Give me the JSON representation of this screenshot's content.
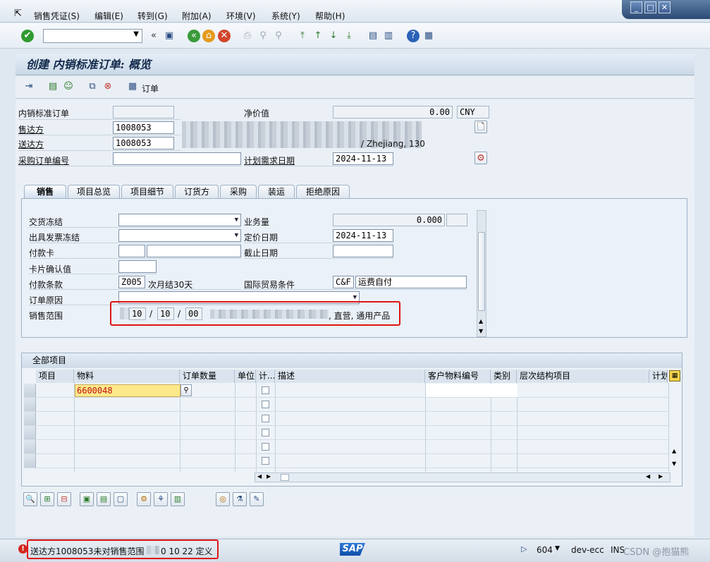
{
  "menu": [
    "销售凭证(S)",
    "编辑(E)",
    "转到(G)",
    "附加(A)",
    "环境(V)",
    "系统(Y)",
    "帮助(H)"
  ],
  "icons": {
    "menu_exit": "exit-icon",
    "enter": "check-icon",
    "save": "save-icon",
    "back": "back-icon",
    "exit": "exit-icon",
    "cancel": "cancel-icon",
    "help": "help-icon"
  },
  "title": "创建 内销标准订单: 概览",
  "apptoolbar": {
    "orders_label": "订单"
  },
  "header": {
    "order_label": "内销标准订单",
    "sold_to_label": "售达方",
    "sold_to_value": "1008053",
    "ship_to_label": "送达方",
    "ship_to_value": "1008053",
    "ship_to_address_tail": "/ Zhejiang, 130",
    "po_label": "采购订单编号",
    "net_value_label": "净价值",
    "net_value": "0.00",
    "currency": "CNY",
    "req_date_label": "计划需求日期",
    "req_date": "2024-11-13"
  },
  "tabs": [
    "销售",
    "项目总览",
    "项目细节",
    "订货方",
    "采购",
    "装运",
    "拒绝原因"
  ],
  "sales_tab": {
    "delivery_block_label": "交货冻结",
    "billing_block_label": "出具发票冻结",
    "payment_card_label": "付款卡",
    "card_verify_label": "卡片确认值",
    "payment_terms_label": "付款条款",
    "payment_terms_code": "Z005",
    "payment_terms_text": "次月结30天",
    "order_reason_label": "订单原因",
    "sales_area_label": "销售范围",
    "sales_area_dc": "10",
    "sales_area_div": "00",
    "sales_area_sep": "/",
    "sales_area_text": ", 直营, 通用产品",
    "volume_label": "业务量",
    "volume_value": "0.000",
    "pricing_date_label": "定价日期",
    "pricing_date": "2024-11-13",
    "expiry_label": "截止日期",
    "incoterms_label": "国际贸易条件",
    "incoterms_code": "C&F",
    "incoterms_text": "运费自付"
  },
  "items_grid": {
    "title": "全部项目",
    "columns": [
      "项目",
      "物料",
      "订单数量",
      "单位",
      "计...",
      "描述",
      "客户物料编号",
      "类别",
      "层次结构项目",
      "计划"
    ],
    "rows": [
      {
        "material": "6600048"
      }
    ]
  },
  "status": {
    "message": "送达方1008053未对销售范围",
    "message_tail": "0 10 22 定义",
    "sap_logo": "SAP",
    "client": "604",
    "system": "dev-ecc",
    "mode": "INS",
    "watermark": "CSDN @抱猫熊"
  }
}
